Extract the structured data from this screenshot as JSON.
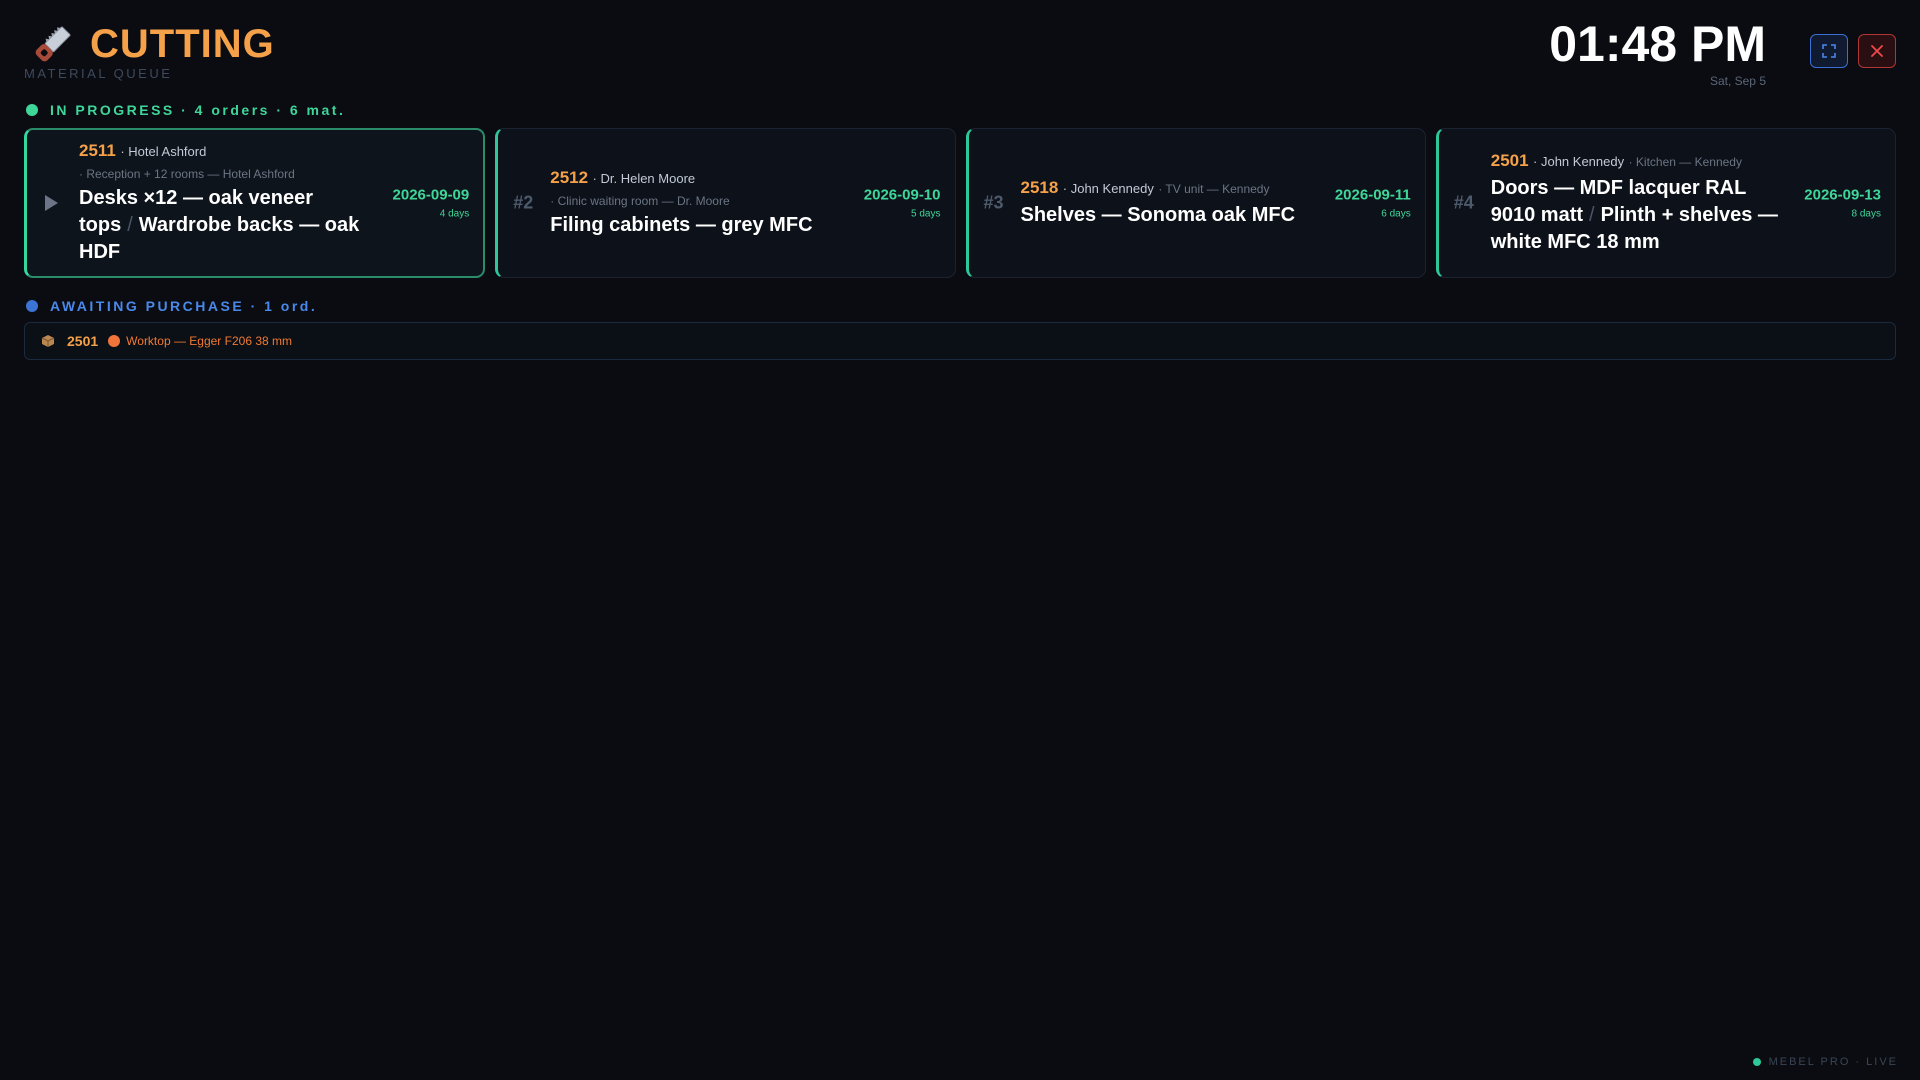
{
  "header": {
    "title": "CUTTING",
    "subtitle": "MATERIAL QUEUE",
    "clock": "01:48 PM",
    "date": "Sat, Sep 5",
    "icon": "saw-icon",
    "fullscreen_icon": "fullscreen-icon",
    "close_icon": "close-icon"
  },
  "in_progress": {
    "label": "IN PROGRESS · 4 orders · 6 mat.",
    "color": "#3fd69a",
    "cards": [
      {
        "indicator": "play-icon",
        "order": "2511",
        "client": "· Hotel Ashford",
        "project": "· Reception + 12 rooms — Hotel Ashford",
        "materials": [
          "Desks ×12 — oak veneer tops",
          "Wardrobe backs — oak HDF"
        ],
        "due_date": "2026-09-09",
        "due_days": "4 days"
      },
      {
        "index": "#2",
        "order": "2512",
        "client": "· Dr. Helen Moore",
        "project": "· Clinic waiting room — Dr. Moore",
        "materials": [
          "Filing cabinets — grey MFC"
        ],
        "due_date": "2026-09-10",
        "due_days": "5 days"
      },
      {
        "index": "#3",
        "order": "2518",
        "client": "· John Kennedy",
        "project": "· TV unit — Kennedy",
        "materials": [
          "Shelves — Sonoma oak MFC"
        ],
        "due_date": "2026-09-11",
        "due_days": "6 days"
      },
      {
        "index": "#4",
        "order": "2501",
        "client": "· John Kennedy",
        "project": "· Kitchen — Kennedy",
        "materials": [
          "Doors — MDF lacquer RAL 9010 matt",
          "Plinth + shelves — white MFC 18 mm"
        ],
        "due_date": "2026-09-13",
        "due_days": "8 days"
      }
    ],
    "separator": "/"
  },
  "awaiting": {
    "label": "AWAITING PURCHASE · 1 ord.",
    "color": "#4a88ea",
    "items": [
      {
        "icon": "package-icon",
        "order": "2501",
        "status_color": "#f0753a",
        "material": "Worktop — Egger F206 38 mm"
      }
    ]
  },
  "footer": {
    "label": "MEBEL PRO · LIVE"
  }
}
